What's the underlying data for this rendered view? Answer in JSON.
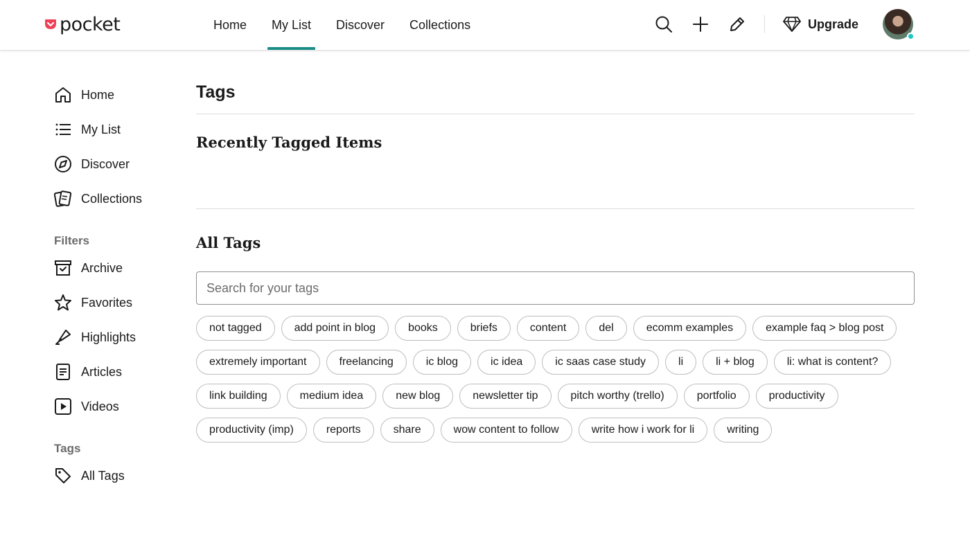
{
  "header": {
    "logo_text": "pocket",
    "nav": [
      {
        "label": "Home",
        "active": false
      },
      {
        "label": "My List",
        "active": true
      },
      {
        "label": "Discover",
        "active": false
      },
      {
        "label": "Collections",
        "active": false
      }
    ],
    "icons": [
      "search-icon",
      "add-icon",
      "edit-icon"
    ],
    "upgrade_label": "Upgrade",
    "accent_color": "#1a8c88",
    "logo_color": "#ef4056"
  },
  "sidebar": {
    "items": [
      {
        "label": "Home",
        "icon": "home-icon"
      },
      {
        "label": "My List",
        "icon": "list-icon"
      },
      {
        "label": "Discover",
        "icon": "compass-icon"
      },
      {
        "label": "Collections",
        "icon": "collections-icon"
      }
    ],
    "filters_heading": "Filters",
    "filters": [
      {
        "label": "Archive",
        "icon": "archive-icon"
      },
      {
        "label": "Favorites",
        "icon": "star-icon"
      },
      {
        "label": "Highlights",
        "icon": "highlighter-icon"
      },
      {
        "label": "Articles",
        "icon": "article-icon"
      },
      {
        "label": "Videos",
        "icon": "video-icon"
      }
    ],
    "tags_heading": "Tags",
    "tags_items": [
      {
        "label": "All Tags",
        "icon": "tag-icon"
      }
    ]
  },
  "main": {
    "title": "Tags",
    "recent_heading": "Recently Tagged Items",
    "all_heading": "All Tags",
    "search_placeholder": "Search for your tags",
    "tags": [
      "not tagged",
      "add point in blog",
      "books",
      "briefs",
      "content",
      "del",
      "ecomm examples",
      "example faq > blog post",
      "extremely important",
      "freelancing",
      "ic blog",
      "ic idea",
      "ic saas case study",
      "li",
      "li + blog",
      "li: what is content?",
      "link building",
      "medium idea",
      "new blog",
      "newsletter tip",
      "pitch worthy (trello)",
      "portfolio",
      "productivity",
      "productivity (imp)",
      "reports",
      "share",
      "wow content to follow",
      "write how i work for li",
      "writing"
    ]
  }
}
